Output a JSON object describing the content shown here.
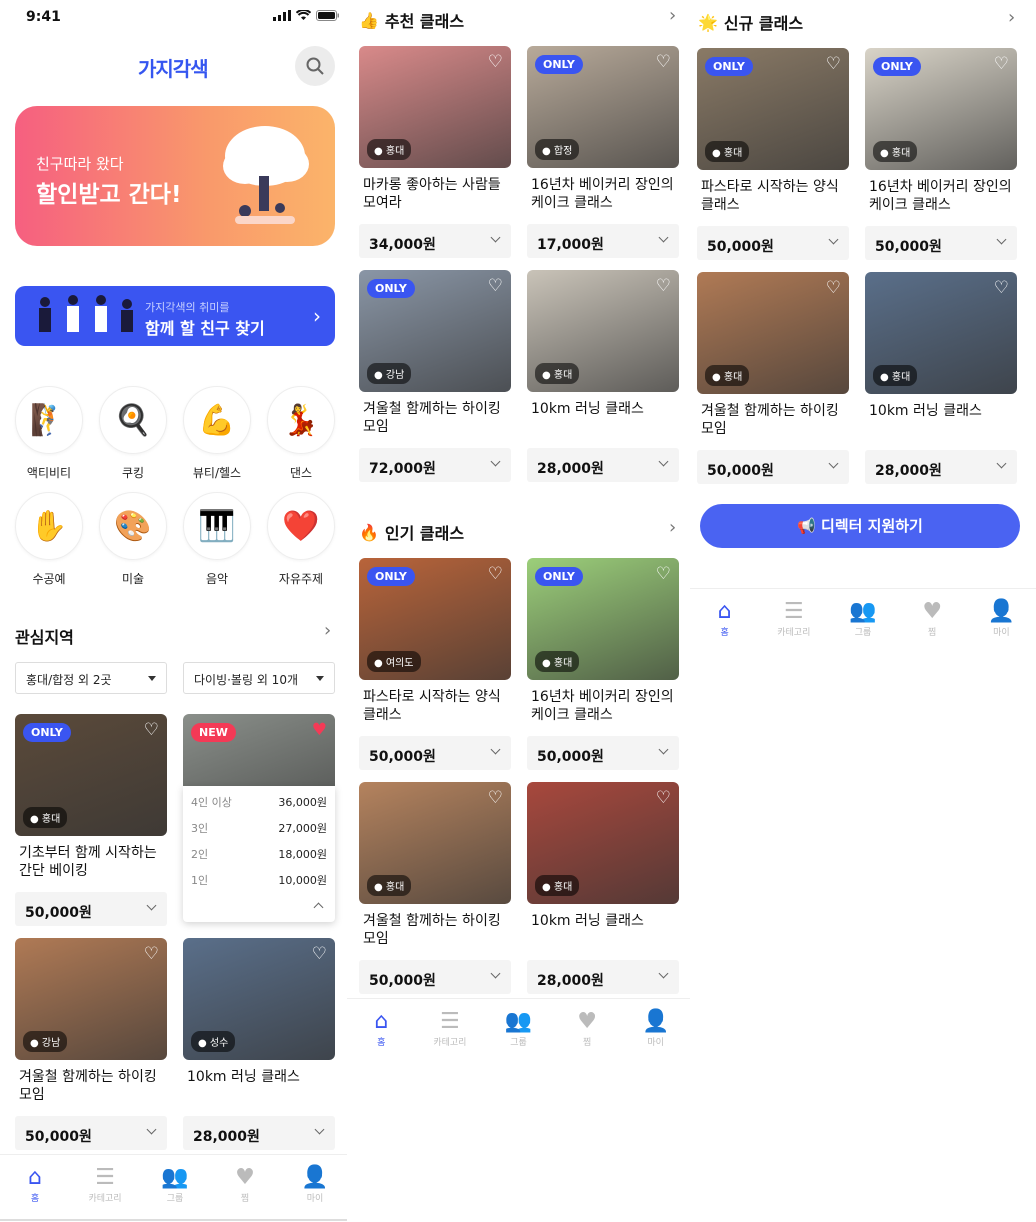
{
  "status": {
    "time": "9:41"
  },
  "app": {
    "logo": "가지각색"
  },
  "banner1": {
    "sub": "친구따라 왔다",
    "main": "할인받고 간다!"
  },
  "banner2": {
    "sub": "가지각색의 취미를",
    "main": "함께 할 친구 찾기"
  },
  "categories": [
    {
      "label": "액티비티",
      "icon": "🧗"
    },
    {
      "label": "쿠킹",
      "icon": "🍳"
    },
    {
      "label": "뷰티/헬스",
      "icon": "💪"
    },
    {
      "label": "댄스",
      "icon": "💃"
    },
    {
      "label": "수공예",
      "icon": "✋"
    },
    {
      "label": "미술",
      "icon": "🎨"
    },
    {
      "label": "음악",
      "icon": "🎹"
    },
    {
      "label": "자유주제",
      "icon": "❤️"
    }
  ],
  "region": {
    "title": "관심지역",
    "filter1": "홍대/합정 외 2곳",
    "filter2": "다이빙·볼링 외 10개"
  },
  "screen1_cards": [
    {
      "badge": "ONLY",
      "loc": "홍대",
      "title": "기초부터 함께 시작하는 간단 베이킹",
      "price": "50,000원",
      "color": "#5b4a3a"
    },
    {
      "badge": "NEW",
      "loc": "",
      "title": "",
      "price": "",
      "color": "#8a8f8a"
    },
    {
      "badge": "",
      "loc": "강남",
      "title": "겨울철 함께하는 하이킹 모임",
      "price": "50,000원",
      "color": "#b07a55"
    },
    {
      "badge": "",
      "loc": "성수",
      "title": "10km 러닝 클래스",
      "price": "28,000원",
      "color": "#5a6f8a"
    }
  ],
  "popup": {
    "rows": [
      {
        "k": "4인 이상",
        "v": "36,000원"
      },
      {
        "k": "3인",
        "v": "27,000원"
      },
      {
        "k": "2인",
        "v": "18,000원"
      },
      {
        "k": "1인",
        "v": "10,000원"
      }
    ]
  },
  "recommended": {
    "title": "추천 클래스",
    "icon": "👍",
    "cards": [
      {
        "badge": "",
        "loc": "홍대",
        "title": "마카롱 좋아하는 사람들 모여라",
        "price": "34,000원",
        "color": "#d98a8a"
      },
      {
        "badge": "ONLY",
        "loc": "합정",
        "title": "16년차 베이커리 장인의 케이크 클래스",
        "price": "17,000원",
        "color": "#b8aa9a"
      },
      {
        "badge": "ONLY",
        "loc": "강남",
        "title": "겨울철 함께하는 하이킹 모임",
        "price": "72,000원",
        "color": "#8a96a6"
      },
      {
        "badge": "",
        "loc": "홍대",
        "title": "10km 러닝 클래스",
        "price": "28,000원",
        "color": "#c9c3b8"
      }
    ]
  },
  "popular": {
    "title": "인기 클래스",
    "icon": "🔥",
    "cards": [
      {
        "badge": "ONLY",
        "loc": "여의도",
        "title": "파스타로 시작하는 양식 클래스",
        "price": "50,000원",
        "color": "#b9643a"
      },
      {
        "badge": "ONLY",
        "loc": "홍대",
        "title": "16년차 베이커리 장인의 케이크 클래스",
        "price": "50,000원",
        "color": "#9ccf7a"
      },
      {
        "badge": "",
        "loc": "홍대",
        "title": "겨울철 함께하는 하이킹 모임",
        "price": "50,000원",
        "color": "#b5835e"
      },
      {
        "badge": "",
        "loc": "홍대",
        "title": "10km 러닝 클래스",
        "price": "28,000원",
        "color": "#a8483d"
      }
    ]
  },
  "newcls": {
    "title": "신규 클래스",
    "icon": "🌟",
    "cards": [
      {
        "badge": "ONLY",
        "loc": "홍대",
        "title": "파스타로 시작하는 양식 클래스",
        "price": "50,000원",
        "color": "#8a7a66"
      },
      {
        "badge": "ONLY",
        "loc": "홍대",
        "title": "16년차 베이커리 장인의 케이크 클래스",
        "price": "50,000원",
        "color": "#d9d4c8"
      },
      {
        "badge": "",
        "loc": "홍대",
        "title": "겨울철 함께하는 하이킹 모임",
        "price": "50,000원",
        "color": "#b07a55"
      },
      {
        "badge": "",
        "loc": "홍대",
        "title": "10km 러닝 클래스",
        "price": "28,000원",
        "color": "#5a6f8a"
      }
    ]
  },
  "apply": {
    "label": "디렉터 지원하기"
  },
  "tabs": [
    {
      "label": "홈",
      "icon": "⌂"
    },
    {
      "label": "카테고리",
      "icon": "☰"
    },
    {
      "label": "그룹",
      "icon": "👥"
    },
    {
      "label": "찜",
      "icon": "♥"
    },
    {
      "label": "마이",
      "icon": "👤"
    }
  ],
  "colors": {
    "accent": "#3a55f1",
    "new": "#f43a56"
  }
}
